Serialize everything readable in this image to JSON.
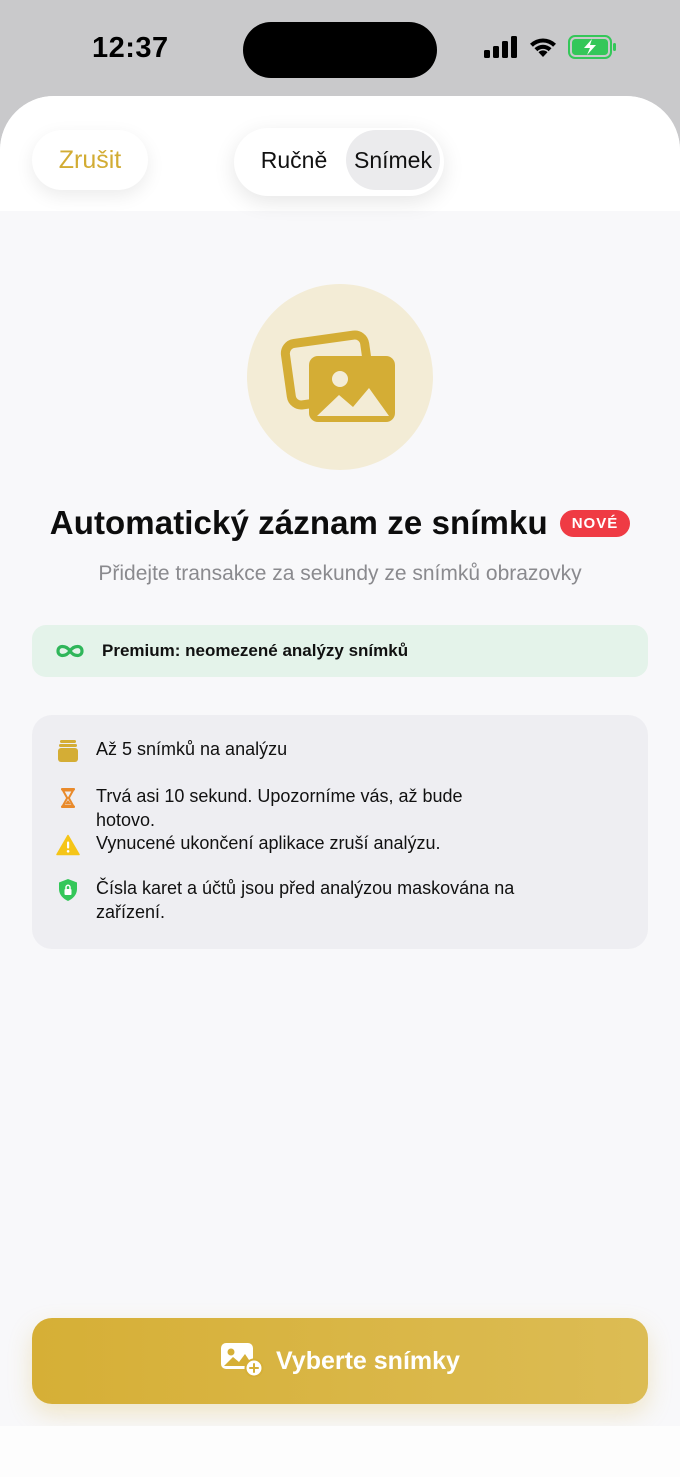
{
  "status_bar": {
    "time": "12:37",
    "icons": [
      "signal-icon",
      "wifi-icon",
      "battery-charging-icon"
    ]
  },
  "header": {
    "cancel_label": "Zrušit",
    "segments": [
      {
        "label": "Ručně",
        "selected": false
      },
      {
        "label": "Snímek",
        "selected": true
      }
    ]
  },
  "hero": {
    "icon": "photos-icon",
    "title": "Automatický záznam ze snímku",
    "badge": "NOVÉ",
    "subtitle": "Přidejte transakce za sekundy ze snímků obrazovky"
  },
  "premium": {
    "icon": "infinity-icon",
    "text": "Premium: neomezené analýzy snímků"
  },
  "info": {
    "items": [
      {
        "icon": "stack-icon",
        "text": "Až 5 snímků na analýzu"
      },
      {
        "icon": "hourglass-icon",
        "text": "Trvá asi 10 sekund. Upozorníme vás, až bude hotovo."
      },
      {
        "icon": "warning-icon",
        "text": "Vynucené ukončení aplikace zruší analýzu."
      },
      {
        "icon": "lock-shield-icon",
        "text": "Čísla karet a účtů jsou před analýzou maskována na zařízení."
      }
    ]
  },
  "cta": {
    "icon": "add-photo-icon",
    "label": "Vyberte snímky"
  },
  "colors": {
    "accent": "#d6af36",
    "badge": "#ef3b44",
    "premium_bg": "#e4f3ea",
    "premium_icon": "#2fb65a",
    "warning": "#f5c518",
    "hourglass": "#e98a2b",
    "shield": "#34c759"
  }
}
